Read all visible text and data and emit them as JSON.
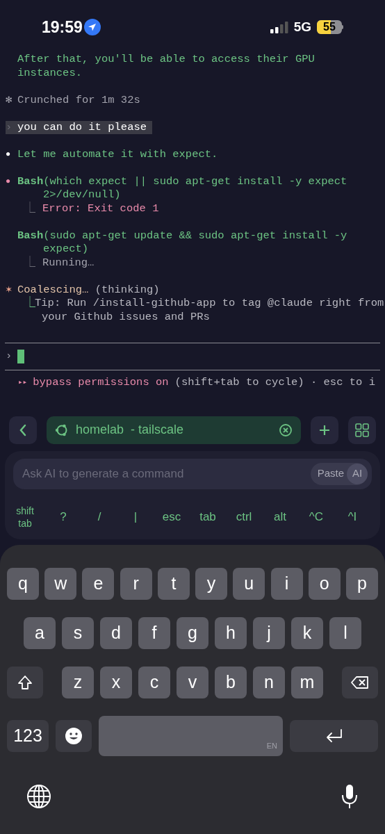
{
  "status_bar": {
    "time": "19:59",
    "network": "5G",
    "battery": "55"
  },
  "terminal": {
    "entries": [
      {
        "kind": "message",
        "lines": [
          "After that, you'll be able to access their GPU",
          "instances."
        ]
      },
      {
        "kind": "status",
        "marker": "✻",
        "text": "Crunched for 1m 32s"
      },
      {
        "kind": "prompt",
        "marker": "›",
        "text": "you can do it please"
      },
      {
        "kind": "message",
        "marker": "●",
        "color": "#ffffff",
        "lines": [
          "Let me automate it with expect."
        ]
      },
      {
        "kind": "tool",
        "marker": "●",
        "color": "#e88aaa",
        "name": "Bash",
        "lines": [
          "(which expect || sudo apt-get install -y expect",
          "2>/dev/null)"
        ],
        "result": {
          "kind": "error",
          "marker": "⎿",
          "text": "Error: Exit code 1"
        }
      },
      {
        "kind": "tool",
        "name": "Bash",
        "lines": [
          "(sudo apt-get update && sudo apt-get install -y",
          "expect)"
        ],
        "result": {
          "kind": "running",
          "marker": "⎿",
          "text": "Running…"
        }
      },
      {
        "kind": "thinking",
        "marker": "✶",
        "text": "Coalescing…",
        "note": "(thinking)",
        "tip": {
          "marker": "⎿",
          "lines": [
            "Tip: Run /install-github-app to tag @claude right from",
            "your Github issues and PRs"
          ]
        }
      }
    ],
    "input": {
      "marker": "›"
    },
    "footer": {
      "marker": "▸▸",
      "mode": "bypass permissions on",
      "hint": "(shift+tab to cycle) · esc to i"
    }
  },
  "session_bar": {
    "tab": {
      "label": "homelab  - tailscale",
      "selected": true
    }
  },
  "ai_field": {
    "placeholder": "Ask AI to generate a command",
    "paste": "Paste",
    "ai": "AI"
  },
  "extra_keys": [
    "shift tab",
    "?",
    "/",
    "|",
    "esc",
    "tab",
    "ctrl",
    "alt",
    "^C",
    "^I"
  ],
  "keyboard": {
    "rows": [
      [
        "q",
        "w",
        "e",
        "r",
        "t",
        "y",
        "u",
        "i",
        "o",
        "p"
      ],
      [
        "a",
        "s",
        "d",
        "f",
        "g",
        "h",
        "j",
        "k",
        "l"
      ],
      [
        "z",
        "x",
        "c",
        "v",
        "b",
        "n",
        "m"
      ]
    ],
    "numbers": "123",
    "space_hint": "EN"
  }
}
